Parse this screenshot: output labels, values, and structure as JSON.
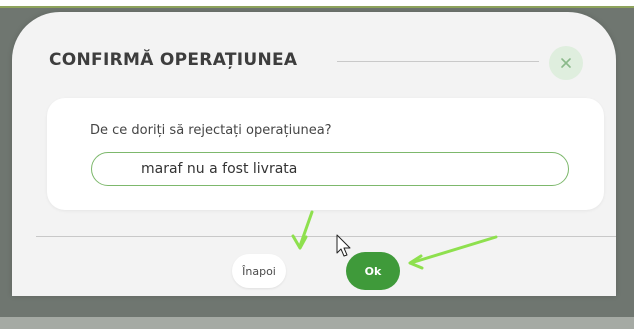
{
  "dialog": {
    "title": "CONFIRMĂ OPERAȚIUNEA",
    "close_icon": "close-icon",
    "question": "De ce doriți să rejectați operațiunea?",
    "reason_value": "maraf nu a fost livrata",
    "back_label": "Înapoi",
    "ok_label": "Ok"
  },
  "annotations": {
    "arrow_color": "#8ee04e",
    "cursor_icon": "mouse-pointer-icon"
  },
  "colors": {
    "accent": "#3f9a3a",
    "input_border": "#7db86c",
    "close_bg": "#dfeede",
    "backdrop": "#6f7670"
  }
}
